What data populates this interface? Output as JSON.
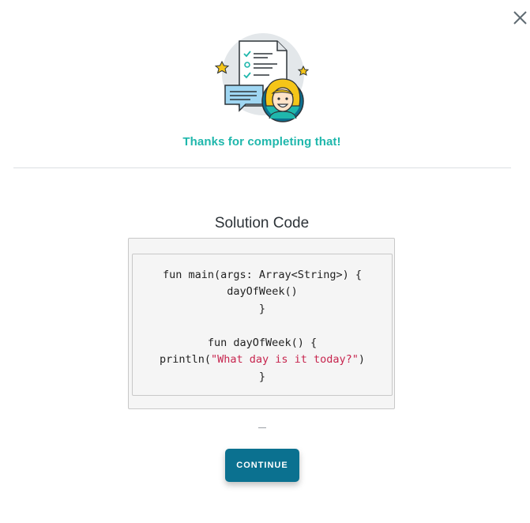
{
  "dialog": {
    "close_icon": "close-icon",
    "illustration_icon": "completion-illustration-icon",
    "message": "Thanks for completing that!",
    "message_color": "#1fb7ac",
    "solution_title": "Solution Code",
    "code": {
      "line1": "fun main(args: Array<String>) {",
      "line2": "dayOfWeek()",
      "line3": "}",
      "line4": "fun dayOfWeek() {",
      "line5_prefix": "println(",
      "line5_string": "\"What day is it today?\"",
      "line5_suffix": ")",
      "line6": "}"
    },
    "continue_label": "CONTINUE",
    "continue_color": "#0b7190"
  }
}
